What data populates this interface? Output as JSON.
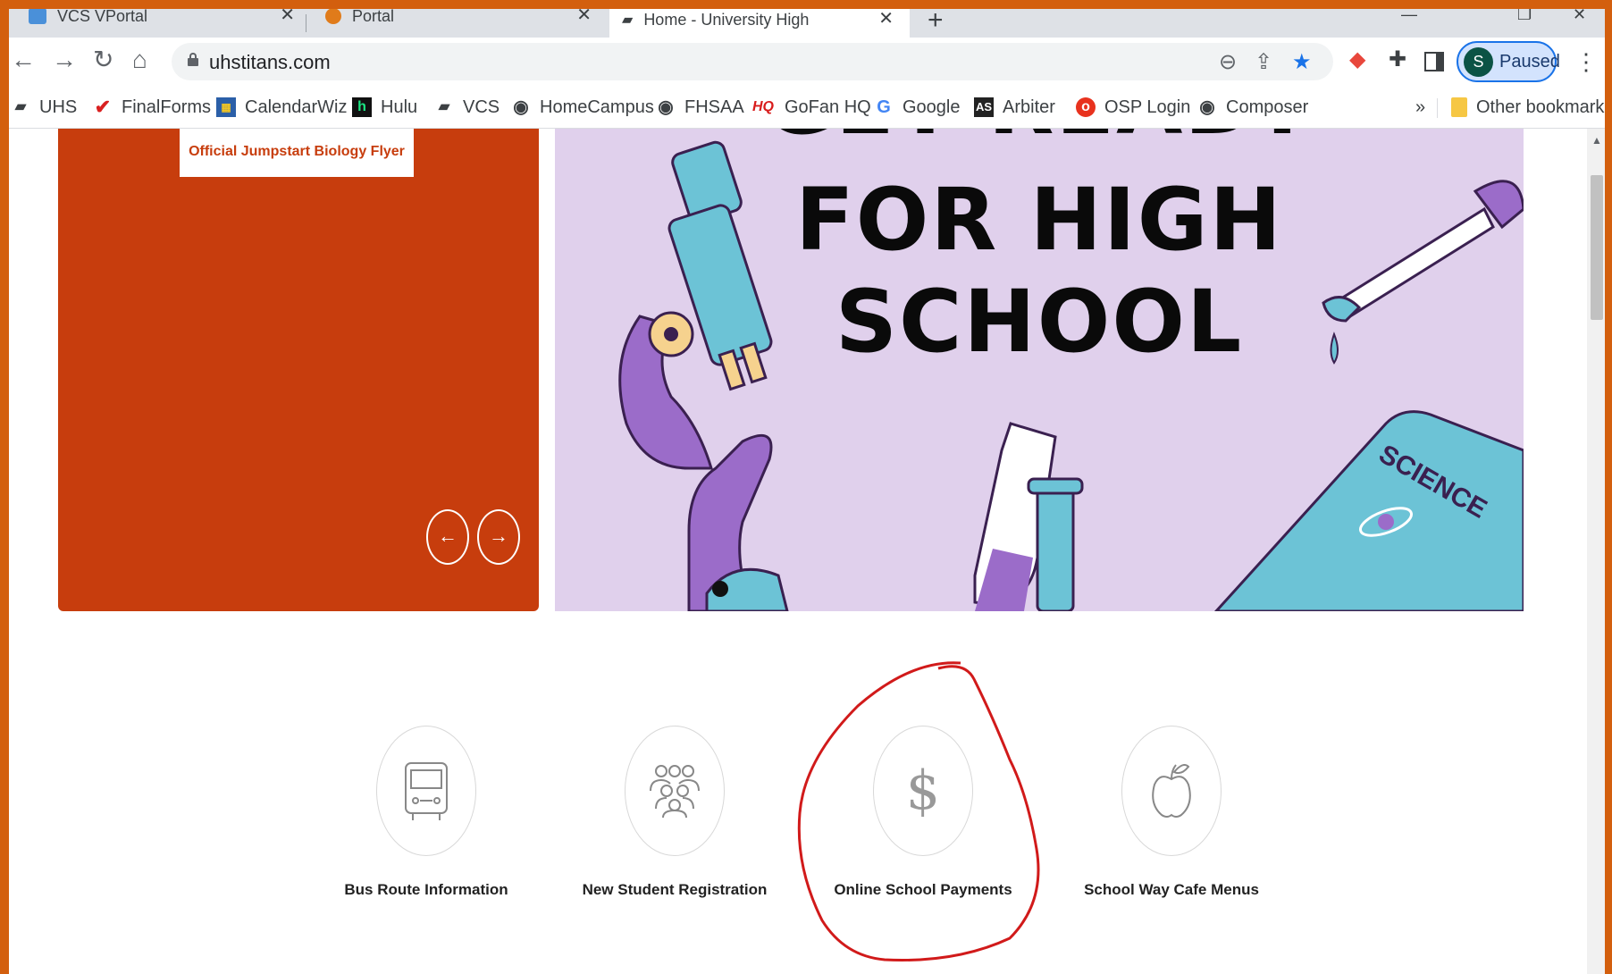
{
  "tabs": [
    {
      "title": "VCS VPortal"
    },
    {
      "title": "Portal"
    },
    {
      "title": "Home - University High",
      "active": true
    }
  ],
  "toolbar": {
    "url": "uhstitans.com",
    "profile_initial": "S",
    "profile_status": "Paused"
  },
  "bookmarks": [
    {
      "label": "UHS",
      "icon": "cap-icon"
    },
    {
      "label": "FinalForms",
      "icon": "check-icon"
    },
    {
      "label": "CalendarWiz",
      "icon": "calendar-icon"
    },
    {
      "label": "Hulu",
      "icon": "hulu-icon"
    },
    {
      "label": "VCS",
      "icon": "cap-icon"
    },
    {
      "label": "HomeCampus",
      "icon": "globe-icon"
    },
    {
      "label": "FHSAA",
      "icon": "globe-icon"
    },
    {
      "label": "GoFan HQ",
      "icon": "hq-icon"
    },
    {
      "label": "Google",
      "icon": "google-icon"
    },
    {
      "label": "Arbiter",
      "icon": "arbiter-icon"
    },
    {
      "label": "OSP Login",
      "icon": "osp-icon"
    },
    {
      "label": "Composer",
      "icon": "globe-icon"
    }
  ],
  "bookmarks_overflow": "»",
  "other_bookmarks": "Other bookmarks",
  "page": {
    "flyer_button": "Official Jumpstart Biology Flyer",
    "hero_lines": [
      "GET READY",
      "FOR HIGH",
      "SCHOOL"
    ],
    "hero_badge": "SCIENCE",
    "quick_links": [
      {
        "label": "Bus Route Information",
        "icon": "bus-icon"
      },
      {
        "label": "New Student Registration",
        "icon": "people-icon"
      },
      {
        "label": "Online School Payments",
        "icon": "dollar-icon"
      },
      {
        "label": "School Way Cafe Menus",
        "icon": "apple-icon"
      }
    ]
  },
  "colors": {
    "frame": "#d35f0e",
    "panel": "#c73d0d",
    "hero_bg": "#e0d0ec",
    "annotation": "#d11a1a"
  }
}
